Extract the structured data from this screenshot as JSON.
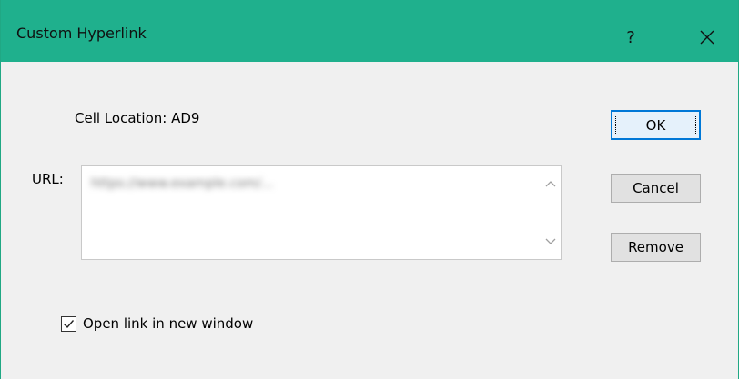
{
  "window": {
    "title": "Custom Hyperlink",
    "help_label": "?",
    "close_icon": "close-icon",
    "title_bar_color": "#1fb08d"
  },
  "cell_location": {
    "label": "Cell Location: AD9"
  },
  "url": {
    "label": "URL:",
    "value": "https://www.example.com/...",
    "scroll_up_icon": "chevron-up-icon",
    "scroll_down_icon": "chevron-down-icon"
  },
  "buttons": {
    "ok": "OK",
    "cancel": "Cancel",
    "remove": "Remove"
  },
  "options": {
    "open_new_window_label": "Open link in new window",
    "open_new_window_checked": true
  },
  "colors": {
    "accent": "#0078d7"
  }
}
